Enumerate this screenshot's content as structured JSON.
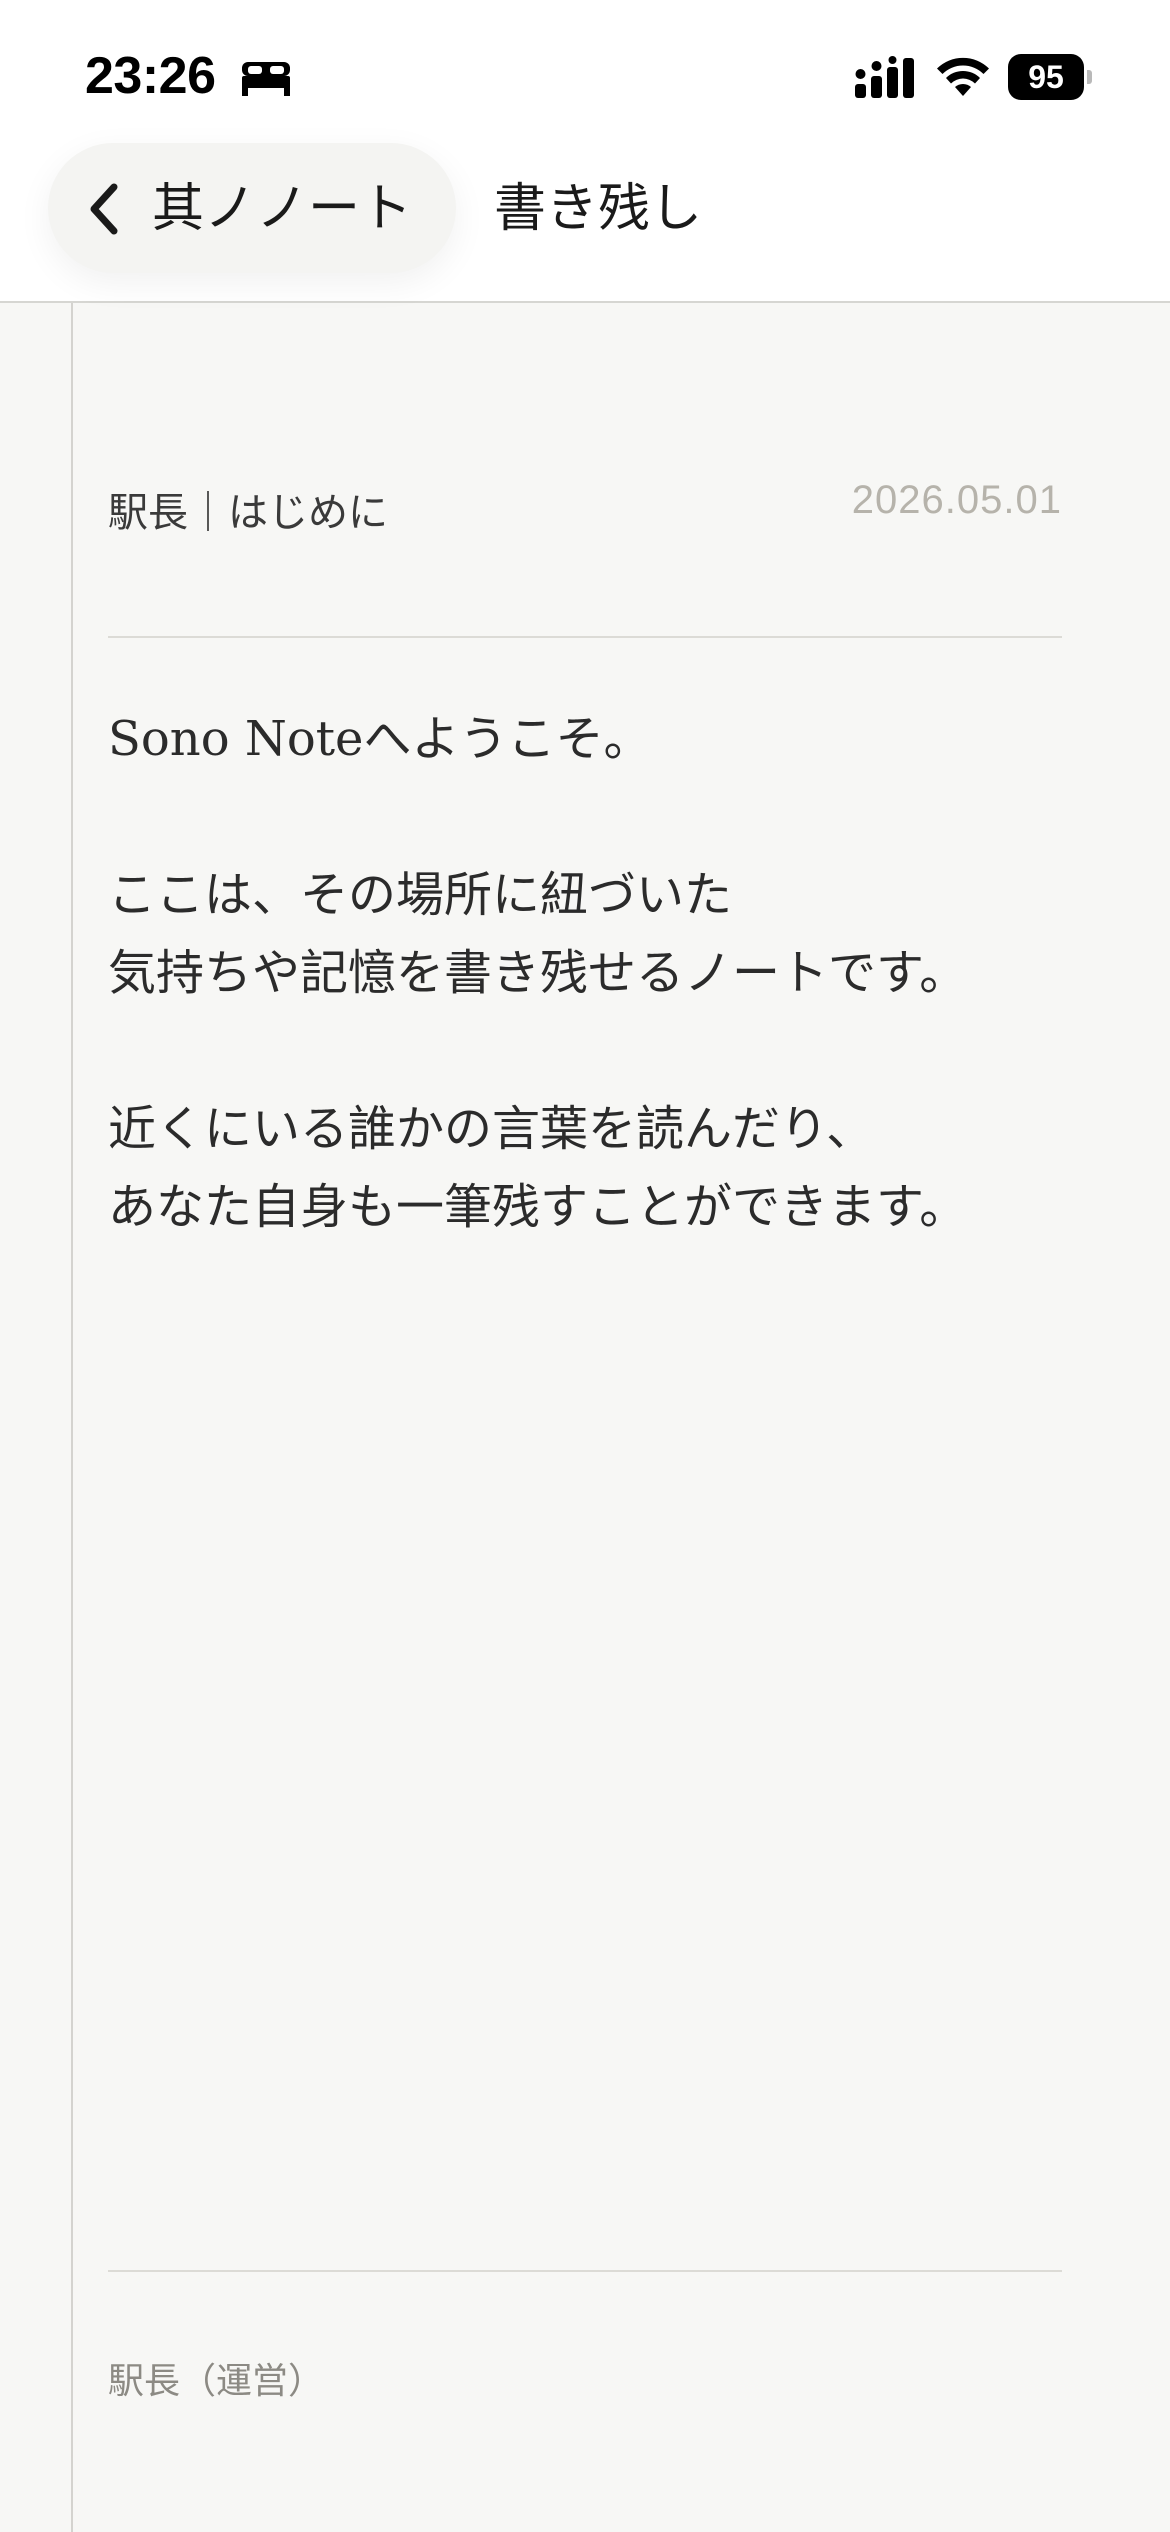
{
  "status_bar": {
    "time": "23:26",
    "focus_icon": "bed-icon",
    "signal_icon": "cellular-signal-icon",
    "wifi_icon": "wifi-icon",
    "battery_level": "95"
  },
  "nav": {
    "back_label": "其ノノート",
    "title": "書き残し"
  },
  "note": {
    "author_line": "駅長｜はじめに",
    "date": "2026.05.01",
    "paragraphs": [
      "Sono Noteへようこそ。",
      "ここは、その場所に紐づいた\n気持ちや記憶を書き残せるノートです。",
      "近くにいる誰かの言葉を読んだり、\nあなた自身も一筆残すことができます。"
    ],
    "signature": "駅長（運営）"
  },
  "colors": {
    "background": "#f7f7f5",
    "header": "#ffffff",
    "date": "#b6b3ab",
    "signature": "#8c8a84"
  }
}
